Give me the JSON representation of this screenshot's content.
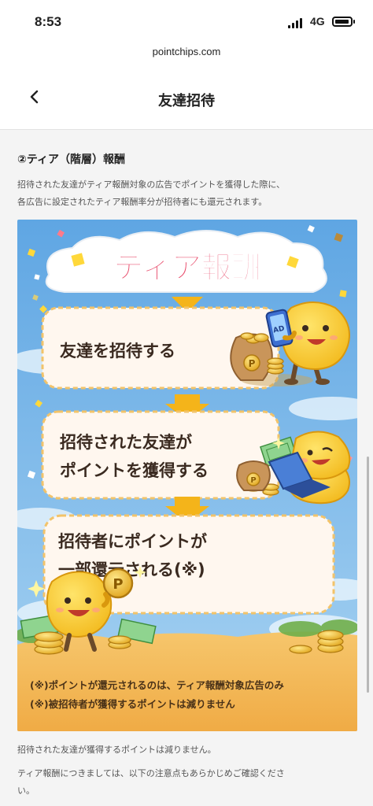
{
  "status_bar": {
    "time": "8:53",
    "network": "4G"
  },
  "browser": {
    "url": "pointchips.com"
  },
  "nav": {
    "title": "友達招待",
    "back_icon": "chevron-left-icon"
  },
  "section": {
    "heading": "②ティア（階層）報酬",
    "intro_line1": "招待された友達がティア報酬対象の広告でポイントを獲得した際に、",
    "intro_line2": "各広告に設定されたティア報酬率分が招待者にも還元されます。"
  },
  "banner": {
    "title": "ティア報酬",
    "step1": "友達を招待する",
    "step2_line1": "招待された友達が",
    "step2_line2": "ポイントを獲得する",
    "step3_line1": "招待者にポイントが",
    "step3_line2": "一部還元される(※)",
    "phone_badge": "AD",
    "coin_letter": "P",
    "note1": "(※)ポイントが還元されるのは、ティア報酬対象広告のみ",
    "note2": "(※)被招待者が獲得するポイントは減りません",
    "colors": {
      "sky": "#6fb1e6",
      "title_text": "#e84a6a",
      "arrow": "#f4b41a",
      "box_bg": "#fff7ef",
      "box_border": "#f2c36a",
      "ground": "#f3b85a",
      "mascot": "#ffd23a"
    }
  },
  "footer": {
    "line1": "招待された友達が獲得するポイントは減りません。",
    "line2": "ティア報酬につきましては、以下の注意点もあらかじめご確認くださ",
    "line3": "い。"
  }
}
